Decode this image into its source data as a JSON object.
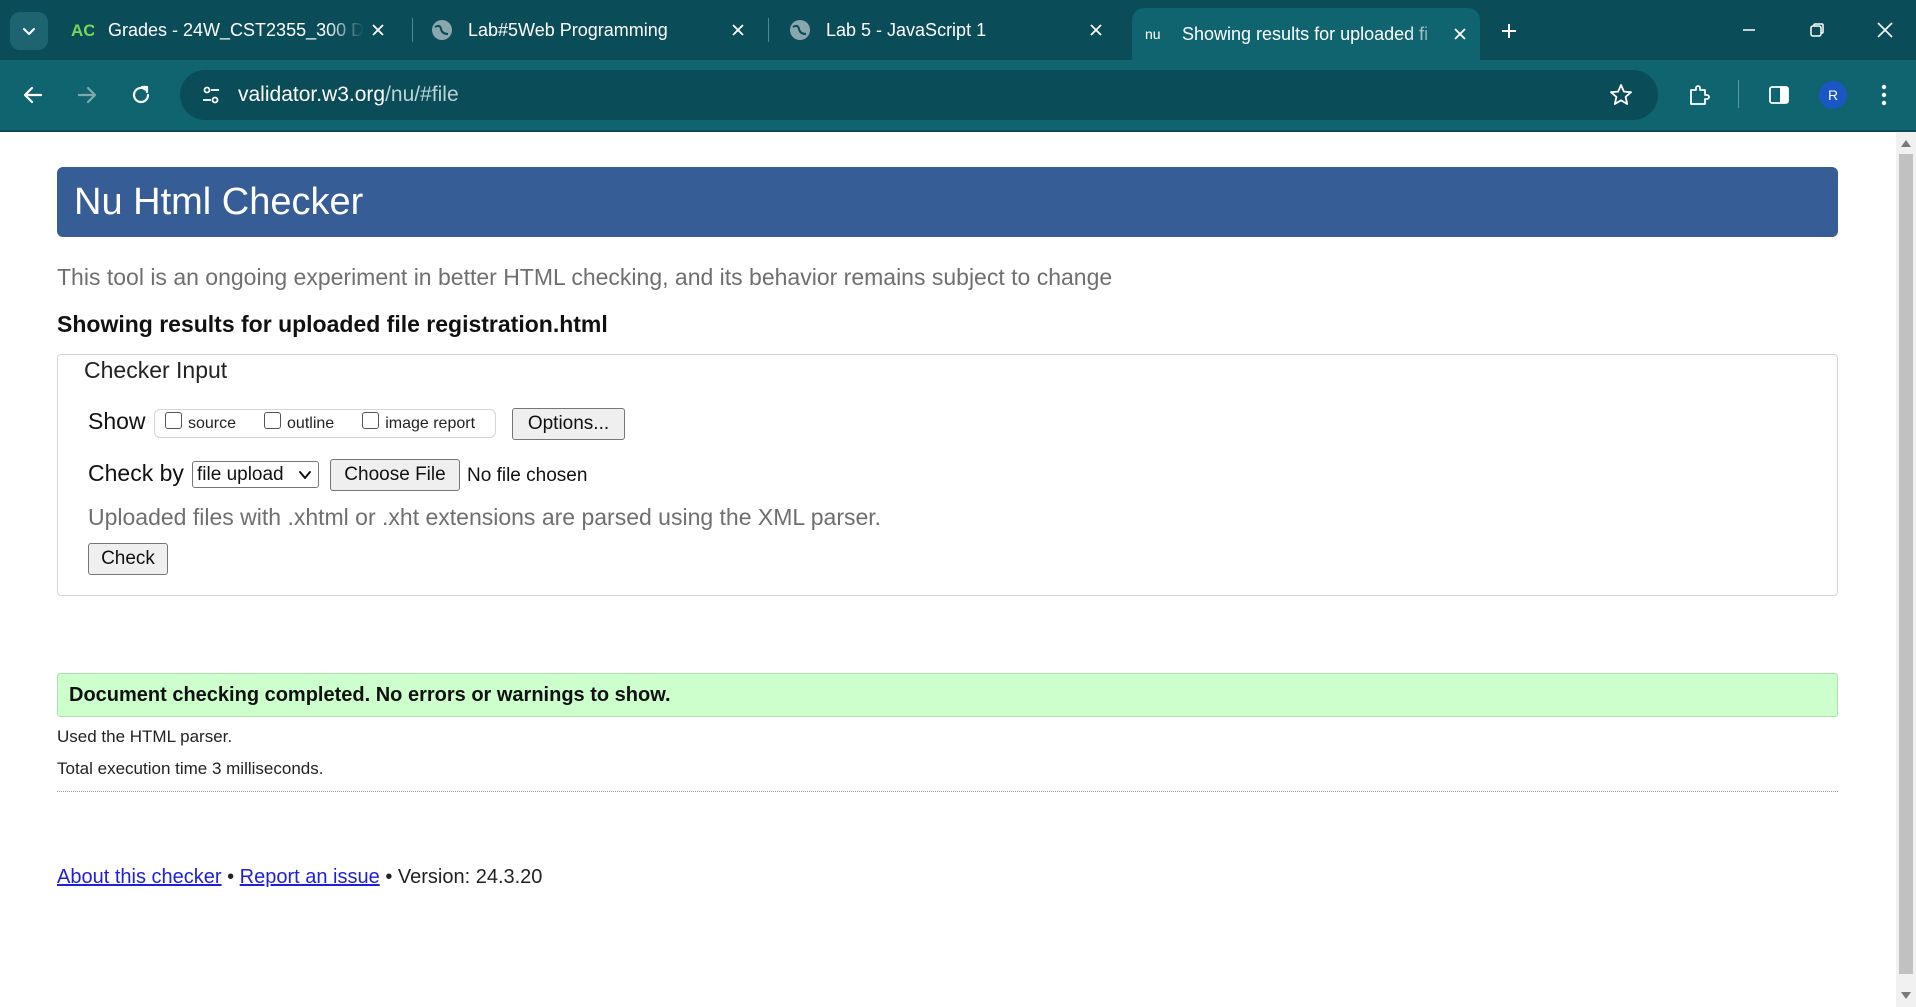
{
  "browser": {
    "tabs": [
      {
        "title": "Grades - 24W_CST2355_300 Da",
        "favicon": "ac-logo-icon",
        "active": false
      },
      {
        "title": "Lab#5Web Programming",
        "favicon": "globe-icon",
        "active": false
      },
      {
        "title": "Lab 5 - JavaScript 1",
        "favicon": "globe-icon",
        "active": false
      },
      {
        "title": "Showing results for uploaded fi",
        "favicon": "nu-logo-icon",
        "favicon_text": "nu",
        "active": true
      }
    ],
    "url": {
      "host": "validator.w3.org",
      "path": "/nu/#file"
    },
    "profile_initial": "R",
    "colors": {
      "tabstrip": "#0a4c57",
      "toolbar": "#0f6470"
    }
  },
  "page": {
    "banner_title": "Nu Html Checker",
    "intro": "This tool is an ongoing experiment in better HTML checking, and its behavior remains subject to change",
    "showing": "Showing results for uploaded file registration.html",
    "checker": {
      "legend": "Checker Input",
      "show_label": "Show",
      "show_options": [
        {
          "label": "source",
          "checked": false
        },
        {
          "label": "outline",
          "checked": false
        },
        {
          "label": "image report",
          "checked": false
        }
      ],
      "options_button": "Options...",
      "check_by_label": "Check by",
      "check_by_value": "file upload",
      "choose_file_button": "Choose File",
      "no_file_text": "No file chosen",
      "hint": "Uploaded files with .xhtml or .xht extensions are parsed using the XML parser.",
      "check_button": "Check"
    },
    "result": {
      "message": "Document checking completed. No errors or warnings to show.",
      "parser": "Used the HTML parser.",
      "exec_time": "Total execution time 3 milliseconds."
    },
    "footer": {
      "about_link": "About this checker",
      "separator": "•",
      "report_link": "Report an issue",
      "version": "• Version: 24.3.20"
    },
    "colors": {
      "banner": "#365d95",
      "success_bg": "#ccffcc",
      "link": "#1f1fd6"
    }
  }
}
